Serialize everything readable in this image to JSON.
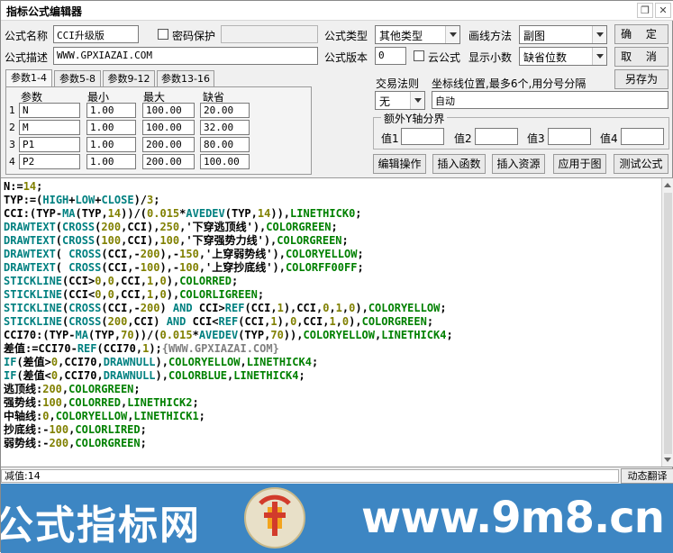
{
  "window": {
    "title": "指标公式编辑器"
  },
  "form": {
    "name_label": "公式名称",
    "name_value": "CCI升级版",
    "password_label": "密码保护",
    "desc_label": "公式描述",
    "desc_value": "WWW.GPXIAZAI.COM",
    "type_label": "公式类型",
    "type_value": "其他类型",
    "draw_label": "画线方法",
    "draw_value": "副图",
    "version_label": "公式版本",
    "version_value": "0",
    "cloud_label": "云公式",
    "decimal_label": "显示小数",
    "decimal_value": "缺省位数"
  },
  "buttons": {
    "ok": "确 定",
    "cancel": "取 消",
    "save_as": "另存为",
    "edit_op": "编辑操作",
    "insert_func": "插入函数",
    "insert_res": "插入资源",
    "apply": "应用于图",
    "test": "测试公式"
  },
  "tabs": [
    "参数1-4",
    "参数5-8",
    "参数9-12",
    "参数13-16"
  ],
  "params": {
    "headers": [
      "参数",
      "最小",
      "最大",
      "缺省"
    ],
    "rows": [
      {
        "n": "1",
        "name": "N",
        "min": "1.00",
        "max": "100.00",
        "def": "20.00"
      },
      {
        "n": "2",
        "name": "M",
        "min": "1.00",
        "max": "100.00",
        "def": "32.00"
      },
      {
        "n": "3",
        "name": "P1",
        "min": "1.00",
        "max": "200.00",
        "def": "80.00"
      },
      {
        "n": "4",
        "name": "P2",
        "min": "1.00",
        "max": "200.00",
        "def": "100.00"
      }
    ]
  },
  "trade": {
    "label": "交易法则",
    "value": "无"
  },
  "coord": {
    "label": "坐标线位置,最多6个,用分号分隔",
    "value": "自动"
  },
  "yaxis": {
    "label": "额外Y轴分界",
    "v1": "值1",
    "v2": "值2",
    "v3": "值3",
    "v4": "值4"
  },
  "status": {
    "text": "减值:14",
    "button": "动态翻译"
  },
  "banner": {
    "cn": "公式指标网",
    "url": "www.9m8.cn"
  },
  "code_lines": [
    "N:=14;",
    "TYP:=(HIGH+LOW+CLOSE)/3;",
    "CCI:(TYP-MA(TYP,14))/(0.015*AVEDEV(TYP,14)),LINETHICK0;",
    "DRAWTEXT(CROSS(200,CCI),250,'下穿逃顶线'),COLORGREEN;",
    "DRAWTEXT(CROSS(100,CCI),100,'下穿强势力线'),COLORGREEN;",
    "DRAWTEXT( CROSS(CCI,-200),-150,'上穿弱势线'),COLORYELLOW;",
    "DRAWTEXT( CROSS(CCI,-100),-100,'上穿抄底线'),COLORFF00FF;",
    "STICKLINE(CCI>0,0,CCI,1,0),COLORRED;",
    "STICKLINE(CCI<0,0,CCI,1,0),COLORLIGREEN;",
    "STICKLINE(CROSS(CCI,-200) AND CCI>REF(CCI,1),CCI,0,1,0),COLORYELLOW;",
    "STICKLINE(CROSS(200,CCI) AND CCI<REF(CCI,1),0,CCI,1,0),COLORGREEN;",
    "CCI70:(TYP-MA(TYP,70))/(0.015*AVEDEV(TYP,70)),COLORYELLOW,LINETHICK4;",
    "差值:=CCI70-REF(CCI70,1);{WWW.GPXIAZAI.COM}",
    "IF(差值>0,CCI70,DRAWNULL),COLORYELLOW,LINETHICK4;",
    "IF(差值<0,CCI70,DRAWNULL),COLORBLUE,LINETHICK4;",
    "逃顶线:200,COLORGREEN;",
    "强势线:100,COLORRED,LINETHICK2;",
    "中轴线:0,COLORYELLOW,LINETHICK1;",
    "抄底线:-100,COLORLIRED;",
    "弱势线:-200,COLORGREEN;"
  ]
}
